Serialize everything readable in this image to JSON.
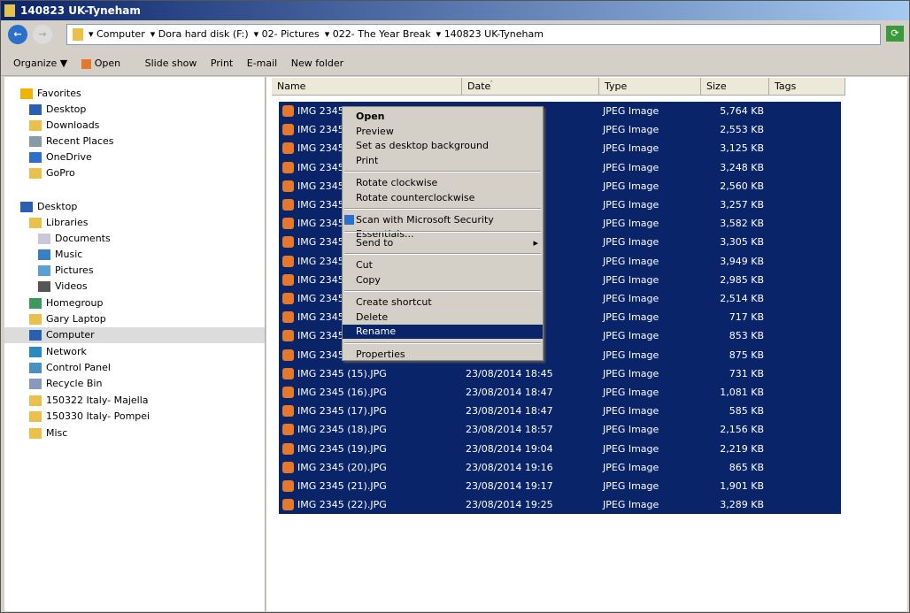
{
  "window": {
    "title": "140823 UK-Tyneham"
  },
  "address": {
    "crumbs": [
      "Computer",
      "Dora hard disk (F:)",
      "02- Pictures",
      "022- The Year Break",
      "140823 UK-Tyneham"
    ]
  },
  "toolbar": {
    "organize": "Organize ▼",
    "open": "Open",
    "slideshow": "Slide show",
    "print": "Print",
    "email": "E-mail",
    "newfolder": "New folder"
  },
  "sidebar": {
    "items": [
      {
        "label": "Favorites",
        "icon": "star-icon",
        "color": "#f0b400"
      },
      {
        "label": "Desktop",
        "icon": "desktop-icon",
        "color": "#2a5fb0"
      },
      {
        "label": "Downloads",
        "icon": "folder-icon",
        "color": "#e8c04a"
      },
      {
        "label": "Recent Places",
        "icon": "recent-icon",
        "color": "#8899aa"
      },
      {
        "label": "OneDrive",
        "icon": "cloud-icon",
        "color": "#2a6fc9"
      },
      {
        "label": "GoPro",
        "icon": "folder-icon",
        "color": "#e8c04a"
      },
      {
        "label": "Desktop",
        "icon": "desktop-icon",
        "color": "#2a5fb0"
      },
      {
        "label": "Libraries",
        "icon": "library-icon",
        "color": "#e8c04a"
      },
      {
        "label": "Documents",
        "icon": "document-icon",
        "color": "#c8c8d8"
      },
      {
        "label": "Music",
        "icon": "music-icon",
        "color": "#3a80c0"
      },
      {
        "label": "Pictures",
        "icon": "picture-icon",
        "color": "#5aa0d0"
      },
      {
        "label": "Videos",
        "icon": "video-icon",
        "color": "#555555"
      },
      {
        "label": "Homegroup",
        "icon": "homegroup-icon",
        "color": "#3a9a5a"
      },
      {
        "label": "Gary Laptop",
        "icon": "folder-icon",
        "color": "#e8c04a"
      },
      {
        "label": "Computer",
        "icon": "computer-icon",
        "color": "#2a5fb0",
        "selected": true
      },
      {
        "label": "Network",
        "icon": "network-icon",
        "color": "#2a8ac0"
      },
      {
        "label": "Control Panel",
        "icon": "control-panel-icon",
        "color": "#4a90c0"
      },
      {
        "label": "Recycle Bin",
        "icon": "recycle-bin-icon",
        "color": "#8899bb"
      },
      {
        "label": "150322 Italy- Majella",
        "icon": "folder-icon",
        "color": "#e8c04a"
      },
      {
        "label": "150330 Italy- Pompei",
        "icon": "folder-icon",
        "color": "#e8c04a"
      },
      {
        "label": "Misc",
        "icon": "folder-icon",
        "color": "#e8c04a"
      }
    ]
  },
  "columns": [
    "Name",
    "Date",
    "Type",
    "Size",
    "Tags"
  ],
  "files": [
    {
      "name": "IMG 2345",
      "date": "",
      "type": "JPEG Image",
      "size": "5,764 KB"
    },
    {
      "name": "IMG 2345",
      "date": "",
      "type": "JPEG Image",
      "size": "2,553 KB"
    },
    {
      "name": "IMG 2345",
      "date": "",
      "type": "JPEG Image",
      "size": "3,125 KB"
    },
    {
      "name": "IMG 2345",
      "date": "",
      "type": "JPEG Image",
      "size": "3,248 KB"
    },
    {
      "name": "IMG 2345",
      "date": "",
      "type": "JPEG Image",
      "size": "2,560 KB"
    },
    {
      "name": "IMG 2345",
      "date": "",
      "type": "JPEG Image",
      "size": "3,257 KB"
    },
    {
      "name": "IMG 2345",
      "date": "",
      "type": "JPEG Image",
      "size": "3,582 KB"
    },
    {
      "name": "IMG 2345",
      "date": "",
      "type": "JPEG Image",
      "size": "3,305 KB"
    },
    {
      "name": "IMG 2345",
      "date": "",
      "type": "JPEG Image",
      "size": "3,949 KB"
    },
    {
      "name": "IMG 2345",
      "date": "",
      "type": "JPEG Image",
      "size": "2,985 KB"
    },
    {
      "name": "IMG 2345",
      "date": "",
      "type": "JPEG Image",
      "size": "2,514 KB"
    },
    {
      "name": "IMG 2345",
      "date": "",
      "type": "JPEG Image",
      "size": "717 KB"
    },
    {
      "name": "IMG 2345",
      "date": "",
      "type": "JPEG Image",
      "size": "853 KB"
    },
    {
      "name": "IMG 2345",
      "date": "",
      "type": "JPEG Image",
      "size": "875 KB"
    },
    {
      "name": "IMG 2345 (15).JPG",
      "date": "23/08/2014 18:45",
      "type": "JPEG Image",
      "size": "731 KB"
    },
    {
      "name": "IMG 2345 (16).JPG",
      "date": "23/08/2014 18:47",
      "type": "JPEG Image",
      "size": "1,081 KB"
    },
    {
      "name": "IMG 2345 (17).JPG",
      "date": "23/08/2014 18:47",
      "type": "JPEG Image",
      "size": "585 KB"
    },
    {
      "name": "IMG 2345 (18).JPG",
      "date": "23/08/2014 18:57",
      "type": "JPEG Image",
      "size": "2,156 KB"
    },
    {
      "name": "IMG 2345 (19).JPG",
      "date": "23/08/2014 19:04",
      "type": "JPEG Image",
      "size": "2,219 KB"
    },
    {
      "name": "IMG 2345 (20).JPG",
      "date": "23/08/2014 19:16",
      "type": "JPEG Image",
      "size": "865 KB"
    },
    {
      "name": "IMG 2345 (21).JPG",
      "date": "23/08/2014 19:17",
      "type": "JPEG Image",
      "size": "1,901 KB"
    },
    {
      "name": "IMG 2345 (22).JPG",
      "date": "23/08/2014 19:25",
      "type": "JPEG Image",
      "size": "3,289 KB"
    }
  ],
  "context_menu": {
    "items": [
      {
        "label": "Open",
        "bold": true
      },
      {
        "label": "Preview"
      },
      {
        "label": "Set as desktop background"
      },
      {
        "label": "Print"
      },
      {
        "sep": true
      },
      {
        "label": "Rotate clockwise"
      },
      {
        "label": "Rotate counterclockwise"
      },
      {
        "sep": true
      },
      {
        "label": "Scan with Microsoft Security Essentials...",
        "icon": "security-essentials-icon"
      },
      {
        "sep": true
      },
      {
        "label": "Send to",
        "submenu": true
      },
      {
        "sep": true
      },
      {
        "label": "Cut"
      },
      {
        "label": "Copy"
      },
      {
        "sep": true
      },
      {
        "label": "Create shortcut"
      },
      {
        "label": "Delete"
      },
      {
        "label": "Rename",
        "highlighted": true
      },
      {
        "sep": true
      },
      {
        "label": "Properties"
      }
    ]
  },
  "colors": {
    "selection": "#0a246a",
    "menu_bg": "#d4d0c8"
  }
}
